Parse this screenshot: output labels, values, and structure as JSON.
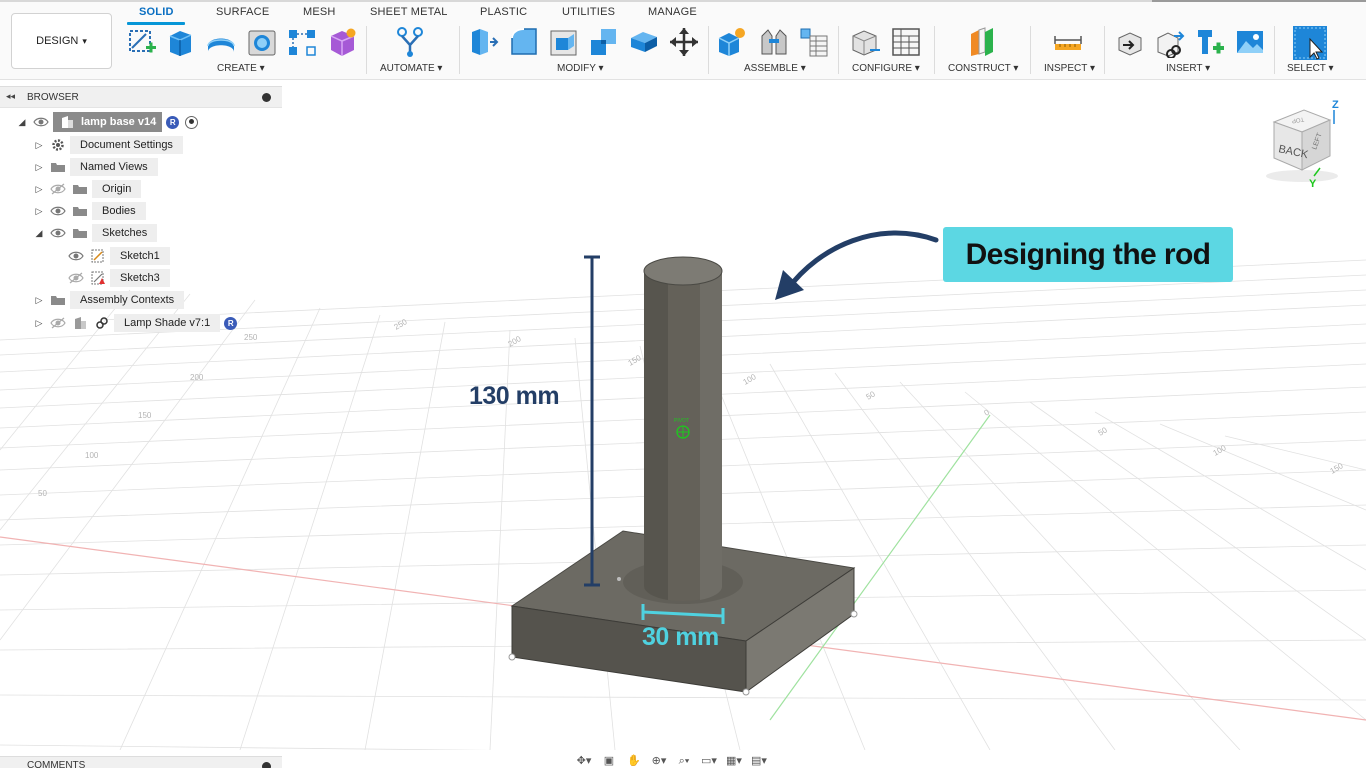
{
  "workspace_button": {
    "label": "DESIGN",
    "caret": "▾"
  },
  "tabs": [
    "SOLID",
    "SURFACE",
    "MESH",
    "SHEET METAL",
    "PLASTIC",
    "UTILITIES",
    "MANAGE"
  ],
  "active_tab": "SOLID",
  "tool_groups": {
    "create": "CREATE ▾",
    "automate": "AUTOMATE ▾",
    "modify": "MODIFY ▾",
    "assemble": "ASSEMBLE ▾",
    "configure": "CONFIGURE ▾",
    "construct": "CONSTRUCT ▾",
    "inspect": "INSPECT ▾",
    "insert": "INSERT ▾",
    "select": "SELECT ▾"
  },
  "tool_icons": {
    "create": [
      "create-sketch-icon",
      "extrude-icon",
      "revolve-icon",
      "hole-icon",
      "pattern-icon",
      "new-form-icon"
    ],
    "automate": [
      "automate-icon"
    ],
    "modify": [
      "press-pull-icon",
      "fillet-icon",
      "shell-icon",
      "combine-icon",
      "replace-face-icon",
      "move-icon"
    ],
    "assemble": [
      "new-component-icon",
      "joint-icon",
      "bom-table-icon"
    ],
    "configure": [
      "configure-icon",
      "configuration-table-icon"
    ],
    "construct": [
      "offset-plane-icon"
    ],
    "inspect": [
      "measure-icon"
    ],
    "insert": [
      "insert-derive-icon",
      "insert-link-icon",
      "insert-mcmaster-icon",
      "decal-icon"
    ],
    "select": [
      "select-icon"
    ]
  },
  "browser": {
    "title": "BROWSER",
    "collapse_icon": "◂◂",
    "root": {
      "label": "lamp base v14",
      "badge": "R"
    },
    "items": [
      {
        "label": "Document Settings",
        "expanded": false
      },
      {
        "label": "Named Views",
        "expanded": false
      },
      {
        "label": "Origin",
        "expanded": false,
        "visible": false
      },
      {
        "label": "Bodies",
        "expanded": false,
        "visible": true
      },
      {
        "label": "Sketches",
        "expanded": true,
        "visible": true
      },
      {
        "label": "Sketch1",
        "visible": true
      },
      {
        "label": "Sketch3",
        "visible": false
      },
      {
        "label": "Assembly Contexts",
        "expanded": false
      },
      {
        "label": "Lamp Shade v7:1",
        "expanded": false,
        "visible": false,
        "badge": "R"
      }
    ]
  },
  "viewport": {
    "pivot_label": "PIVOT",
    "grid_labels_left": [
      "250",
      "200",
      "150",
      "100",
      "50"
    ],
    "grid_labels_top": [
      "250",
      "200",
      "150",
      "100",
      "50",
      "0",
      "50",
      "100",
      "150"
    ]
  },
  "navcube": {
    "face_back": "BACK",
    "face_left": "LEFT",
    "face_top": "TOP",
    "axis_z": "Z",
    "axis_y": "Y"
  },
  "annotations": {
    "height": "130 mm",
    "diameter": "30 mm",
    "callout": "Designing the rod"
  },
  "colors": {
    "callout_bg": "#5cd7e3",
    "height_annotation": "#233e66",
    "diameter_annotation": "#4fd2e0",
    "active_tab": "#0696d7",
    "model_body": "#6c6a63"
  },
  "comments": {
    "title": "COMMENTS"
  },
  "navbar": {
    "icons": [
      "orbit-icon",
      "look-at-icon",
      "pan-icon",
      "zoom-window-icon",
      "zoom-fit-icon",
      "display-settings-icon",
      "grid-settings-icon",
      "viewports-icon"
    ],
    "glyphs": [
      "✥▾",
      "▣",
      "✋",
      "⊕▾",
      "⌕▾",
      "▭▾",
      "▦▾",
      "▤▾"
    ]
  }
}
